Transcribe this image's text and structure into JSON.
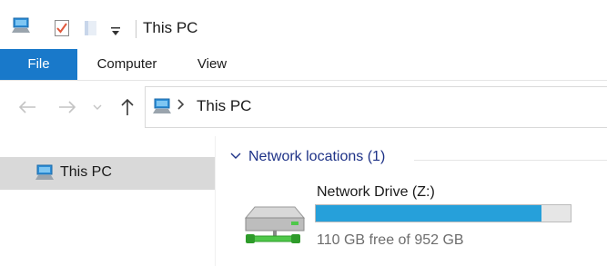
{
  "window": {
    "title": "This PC"
  },
  "quick_access": {
    "icons": [
      "computer-icon",
      "properties-checkbox-icon",
      "new-folder-icon",
      "customize-dropdown-icon"
    ]
  },
  "ribbon": {
    "tabs": [
      {
        "label": "File",
        "active": true
      },
      {
        "label": "Computer",
        "active": false
      },
      {
        "label": "View",
        "active": false
      }
    ]
  },
  "nav": {
    "address": {
      "segments": [
        "This PC"
      ]
    }
  },
  "sidebar": {
    "items": [
      {
        "label": "This PC",
        "selected": true
      }
    ]
  },
  "content": {
    "group": {
      "label": "Network locations (1)"
    },
    "drive": {
      "name": "Network Drive (Z:)",
      "free_text": "110 GB free of 952 GB",
      "free_gb": 110,
      "total_gb": 952,
      "used_fraction": 0.8845
    }
  },
  "colors": {
    "accent": "#1979ca",
    "usage_bar": "#26a0da",
    "group_header": "#1e3287"
  }
}
